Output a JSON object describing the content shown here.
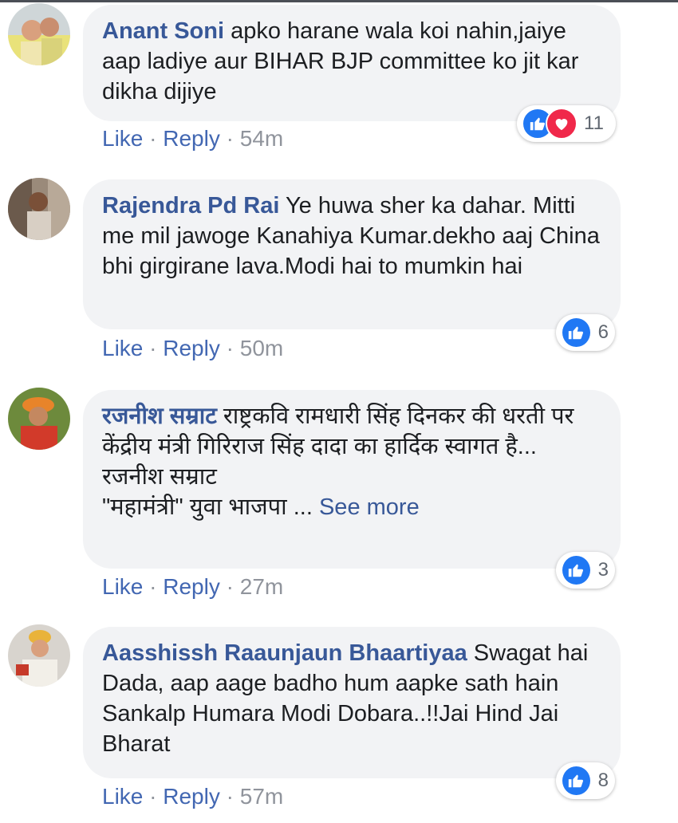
{
  "comments": [
    {
      "author": "Anant Soni",
      "text": "apko harane wala koi nahin,jaiye aap ladiye aur BIHAR BJP committee ko jit kar dikha dijiye",
      "like_label": "Like",
      "reply_label": "Reply",
      "time": "54m",
      "reaction_count": "11",
      "reactions": [
        "like-icon",
        "love-icon"
      ]
    },
    {
      "author": "Rajendra Pd Rai",
      "text": "Ye huwa sher ka dahar. Mitti me mil jawoge Kanahiya Kumar.dekho aaj China bhi girgirane lava.Modi hai to mumkin hai",
      "like_label": "Like",
      "reply_label": "Reply",
      "time": "50m",
      "reaction_count": "6",
      "reactions": [
        "like-icon"
      ]
    },
    {
      "author": "रजनीश सम्राट",
      "text": "राष्ट्रकवि रामधारी सिंह दिनकर की धरती पर केंद्रीय मंत्री गिरिराज सिंह दादा का हार्दिक स्वागत है...",
      "text_line2": "रजनीश सम्राट",
      "text_line3": "\"महामंत्री\" युवा भाजपा ...",
      "see_more": "See more",
      "like_label": "Like",
      "reply_label": "Reply",
      "time": "27m",
      "reaction_count": "3",
      "reactions": [
        "like-icon"
      ]
    },
    {
      "author": "Aasshissh Raaunjaun Bhaartiyaa",
      "text": "Swagat hai Dada, aap aage badho hum aapke sath hain Sankalp Humara Modi Dobara..!!Jai Hind Jai Bharat",
      "like_label": "Like",
      "reply_label": "Reply",
      "time": "57m",
      "reaction_count": "8",
      "reactions": [
        "like-icon"
      ]
    }
  ],
  "separator": "·",
  "colors": {
    "author": "#385898",
    "link": "#4267b2",
    "bubble": "#f2f3f5",
    "like": "#2078f4",
    "love": "#f0284a",
    "meta": "#90949c"
  }
}
